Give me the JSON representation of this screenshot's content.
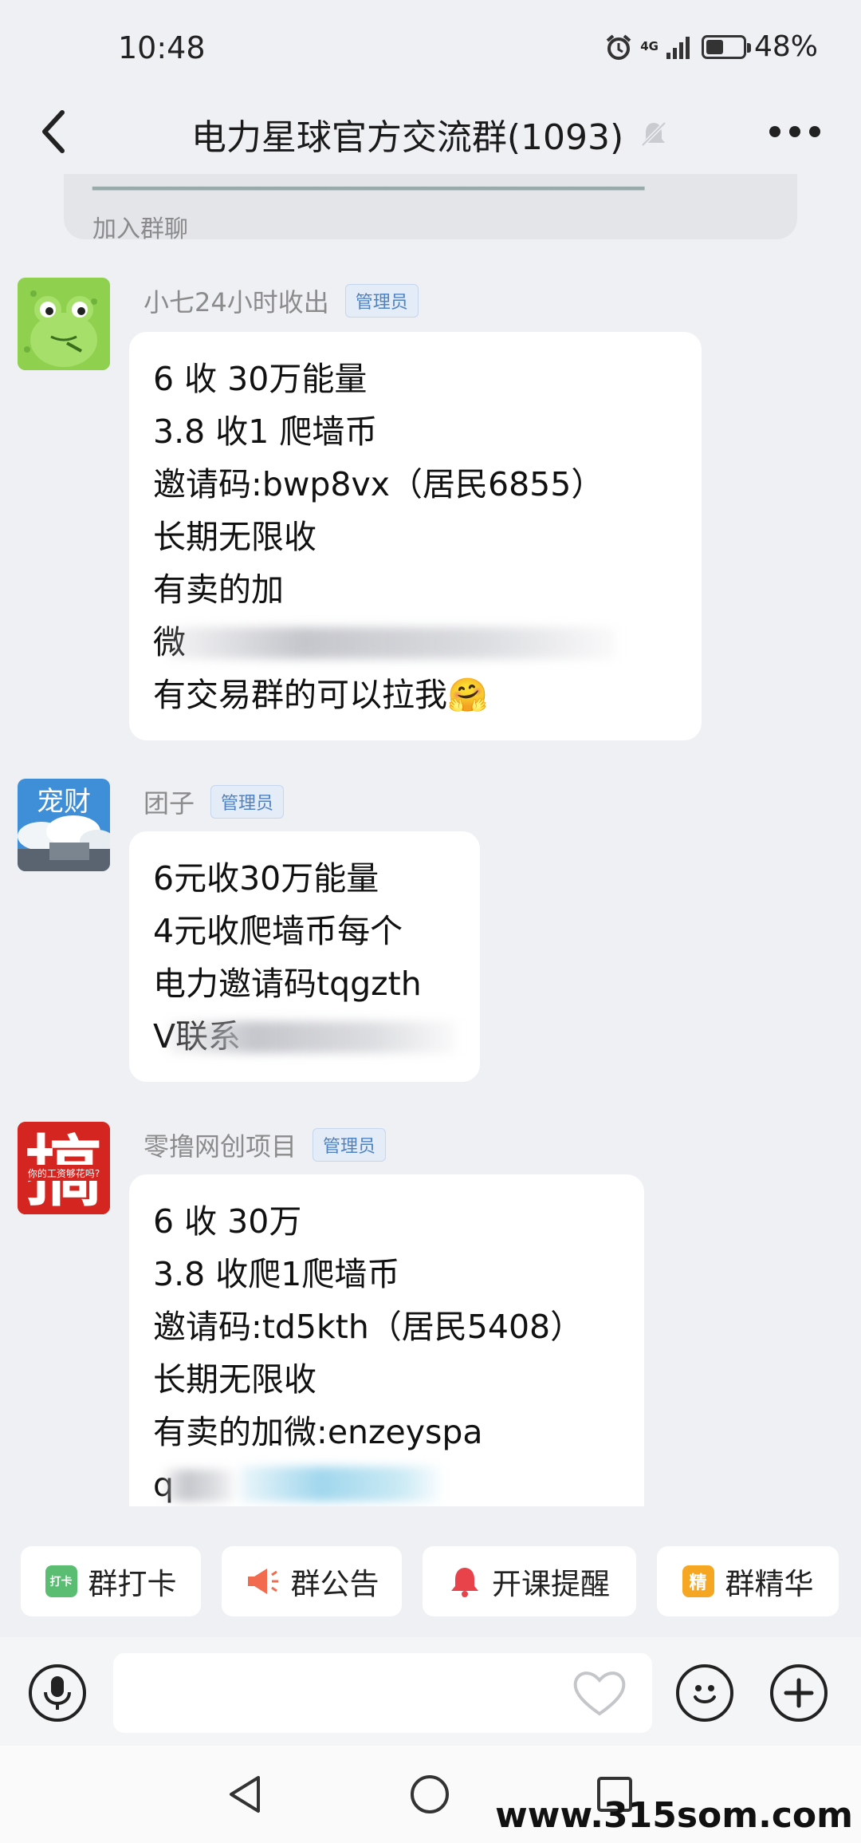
{
  "status_bar": {
    "time": "10:48",
    "network": "4G",
    "battery": "48%",
    "battery_level": 0.48
  },
  "header": {
    "title": "电力星球官方交流群(1093)"
  },
  "system_notice": {
    "text": "加入群聊"
  },
  "messages": [
    {
      "sender": "小七24小时收出",
      "role": "管理员",
      "lines": [
        "6  收  30万能量",
        "3.8    收1 爬墙币",
        "邀请码:bwp8vx（居民6855）",
        "长期无限收",
        "有卖的加",
        "微",
        "有交易群的可以拉我🤗"
      ]
    },
    {
      "sender": "团子",
      "role": "管理员",
      "avatar_text": "宠财",
      "lines": [
        "6元收30万能量",
        "4元收爬墙币每个",
        "电力邀请码tqgzth",
        "V联系"
      ]
    },
    {
      "sender": "零撸网创项目",
      "role": "管理员",
      "avatar_text": "搞",
      "avatar_subtext": "你的工资够花吗?",
      "lines": [
        "6     收  30万",
        "3.8  收爬1爬墙币",
        "邀请码:td5kth（居民5408）",
        "长期无限收",
        "有卖的加微:enzeyspa",
        "q"
      ]
    }
  ],
  "toolbar": [
    {
      "label": "群打卡",
      "icon_text": "打卡",
      "color": "#5bbd72"
    },
    {
      "label": "群公告",
      "color": "#f26b4f"
    },
    {
      "label": "开课提醒",
      "color": "#e8434b"
    },
    {
      "label": "群精华",
      "icon_text": "精",
      "color": "#f5a623"
    }
  ],
  "watermark": "www.315som.com"
}
